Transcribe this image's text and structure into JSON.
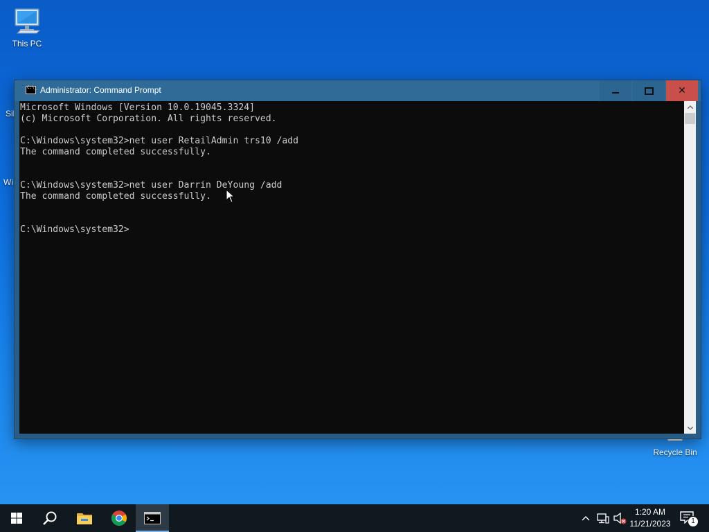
{
  "desktop": {
    "icons": [
      {
        "label": "This PC",
        "icon": "computer-icon"
      },
      {
        "label": "Recycle Bin",
        "icon": "recycle-bin-icon"
      }
    ],
    "partial_labels": [
      "Sil",
      "Wi"
    ]
  },
  "window": {
    "title": "Administrator: Command Prompt",
    "controls": {
      "minimize": "minimize-icon",
      "maximize": "maximize-icon",
      "close": "close-icon"
    },
    "console_lines": [
      "Microsoft Windows [Version 10.0.19045.3324]",
      "(c) Microsoft Corporation. All rights reserved.",
      "",
      "C:\\Windows\\system32>net user RetailAdmin trs10 /add",
      "The command completed successfully.",
      "",
      "",
      "C:\\Windows\\system32>net user Darrin DeYoung /add",
      "The command completed successfully.",
      "",
      "",
      "C:\\Windows\\system32>"
    ]
  },
  "taskbar": {
    "items": [
      {
        "name": "start",
        "icon": "windows-logo-icon"
      },
      {
        "name": "search",
        "icon": "search-icon"
      },
      {
        "name": "file-explorer",
        "icon": "folder-icon"
      },
      {
        "name": "chrome",
        "icon": "chrome-icon"
      },
      {
        "name": "command-prompt",
        "icon": "cmd-icon",
        "active": true
      }
    ],
    "tray": {
      "time": "1:20 AM",
      "date": "11/21/2023",
      "notification_count": "1"
    }
  },
  "colors": {
    "console_bg": "#0c0c0c",
    "console_text": "#cccccc",
    "titlebar": "#2f6b96",
    "close_button": "#c9504a",
    "taskbar": "#101820"
  }
}
